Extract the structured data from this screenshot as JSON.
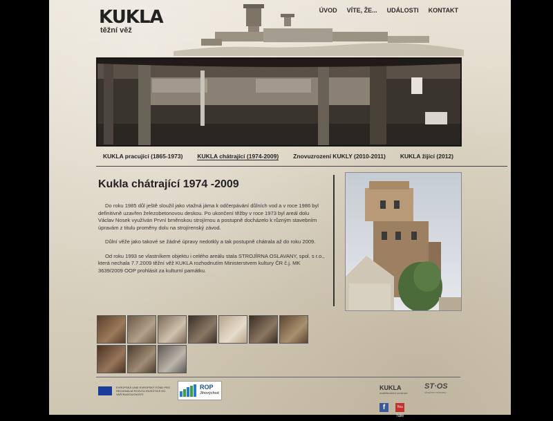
{
  "logo": {
    "word": "KUKLA",
    "sub": "těžní věž"
  },
  "topnav": [
    "ÚVOD",
    "VÍTE, ŽE...",
    "UDÁLOSTI",
    "KONTAKT"
  ],
  "subnav": [
    "KUKLA pracující (1865-1973)",
    "KUKLA chátrající (1974-2009)",
    "Znovuzrození KUKLY (2010-2011)",
    "KUKLA žijící (2012)"
  ],
  "main": {
    "title": "Kukla chátrající 1974 -2009",
    "paragraphs": [
      "Do roku 1985 důl ještě sloužil jako vtažná jáma k odčerpávání důlních vod a v roce 1986 byl definitivně uzavřen železobetonovou deskou. Po ukončení těžby v roce 1973 byl areál dolu Václav Nosek využíván První brněnskou strojírnou a postupně docházelo k různým stavebním úpravám z titulu proměny dolu na strojírenský závod.",
      "Důlní věže jako takové se žádné úpravy nedotkly a tak postupně chátrala až do roku 2009.",
      "Od roku 1993 se vlastníkem objektu i celého areálu stala STROJÍRNA OSLAVANY, spol. s r.o., která nechala 7.7.2009 těžní věž KUKLA rozhodnutím Ministerstvem kultury ČR č.j. MK 3639/2009 OOP prohlásit za kulturní památku."
    ]
  },
  "thumbs": [
    {
      "c1": "#5a3f2c",
      "c2": "#9a7a5a"
    },
    {
      "c1": "#6b5846",
      "c2": "#b3a089"
    },
    {
      "c1": "#7c6a58",
      "c2": "#cfc1ac"
    },
    {
      "c1": "#3b3028",
      "c2": "#8a7865"
    },
    {
      "c1": "#b7a58d",
      "c2": "#e6dccb"
    },
    {
      "c1": "#3a2e24",
      "c2": "#8b7761"
    },
    {
      "c1": "#5d4532",
      "c2": "#a9916f"
    },
    {
      "c1": "#4a3322",
      "c2": "#97755a"
    },
    {
      "c1": "#4d3d30",
      "c2": "#a08c74"
    },
    {
      "c1": "#5e5a55",
      "c2": "#bcb6ab"
    }
  ],
  "footer": {
    "eu_text": "EVROPSKÁ UNIE EVROPSKÝ FOND PRO REGIONÁLNÍ ROZVOJ INVESTICE DO VAŠÍ BUDOUCNOSTI",
    "rop_label": "ROP",
    "rop_sub": "Jihovýchod",
    "kukla_small": "KUKLA",
    "kukla_small_sub": "multifunkční centrum",
    "stroj": "ST·OS",
    "stroj_sub": "strojírna oslavany",
    "facebook": "f",
    "youtube": "You Tube"
  },
  "colors": {
    "paper": "#e3dccb",
    "text": "#222222",
    "eu_blue": "#1a3d99",
    "rop_blue": "#1c4d9c",
    "fb_blue": "#3b5998",
    "yt_red": "#c4302b"
  }
}
